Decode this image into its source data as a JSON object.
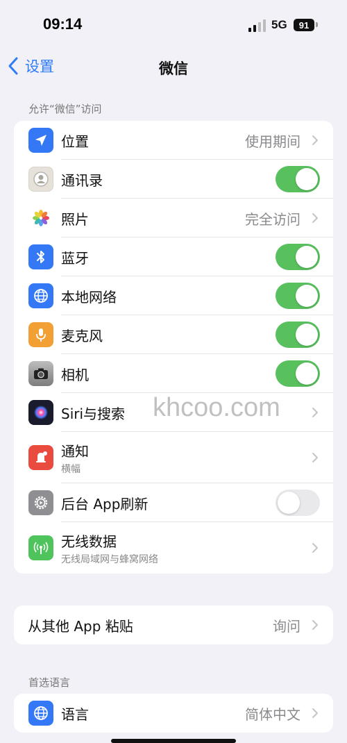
{
  "status": {
    "time": "09:14",
    "network": "5G",
    "battery": "91"
  },
  "nav": {
    "back_label": "设置",
    "title": "微信"
  },
  "section1": {
    "header": "允许“微信”访问",
    "rows": [
      {
        "label": "位置",
        "value": "使用期间",
        "icon": "location-arrow-icon",
        "icon_color": "#3478f6"
      },
      {
        "label": "通讯录",
        "toggle": true,
        "icon": "contacts-icon",
        "icon_color": "#e6e2da"
      },
      {
        "label": "照片",
        "value": "完全访问",
        "icon": "photos-icon",
        "icon_color": "#ffffff"
      },
      {
        "label": "蓝牙",
        "toggle": true,
        "icon": "bluetooth-icon",
        "icon_color": "#3478f6"
      },
      {
        "label": "本地网络",
        "toggle": true,
        "icon": "globe-icon",
        "icon_color": "#3478f6"
      },
      {
        "label": "麦克风",
        "toggle": true,
        "icon": "microphone-icon",
        "icon_color": "#f2a033"
      },
      {
        "label": "相机",
        "toggle": true,
        "icon": "camera-icon",
        "icon_color": "#8e8e8e"
      },
      {
        "label": "Siri与搜索",
        "icon": "siri-icon",
        "icon_color": "#1b1b2e"
      },
      {
        "label": "通知",
        "sub": "横幅",
        "icon": "notification-bell-icon",
        "icon_color": "#ea4b3f"
      },
      {
        "label": "后台 App刷新",
        "toggle": false,
        "icon": "gear-icon",
        "icon_color": "#8e8e93"
      },
      {
        "label": "无线数据",
        "sub": "无线局域网与蜂窝网络",
        "icon": "antenna-icon",
        "icon_color": "#4fc35c"
      }
    ]
  },
  "section2": {
    "rows": [
      {
        "label": "从其他 App 粘贴",
        "value": "询问"
      }
    ]
  },
  "section3": {
    "header": "首选语言",
    "rows": [
      {
        "label": "语言",
        "value": "简体中文",
        "icon": "globe-icon",
        "icon_color": "#3478f6"
      }
    ]
  },
  "watermark": "khcoo.com",
  "colors": {
    "accent": "#2f7cf6",
    "toggle_on": "#59c05e",
    "toggle_off": "#e9e9ec",
    "background": "#f2f1f7"
  }
}
